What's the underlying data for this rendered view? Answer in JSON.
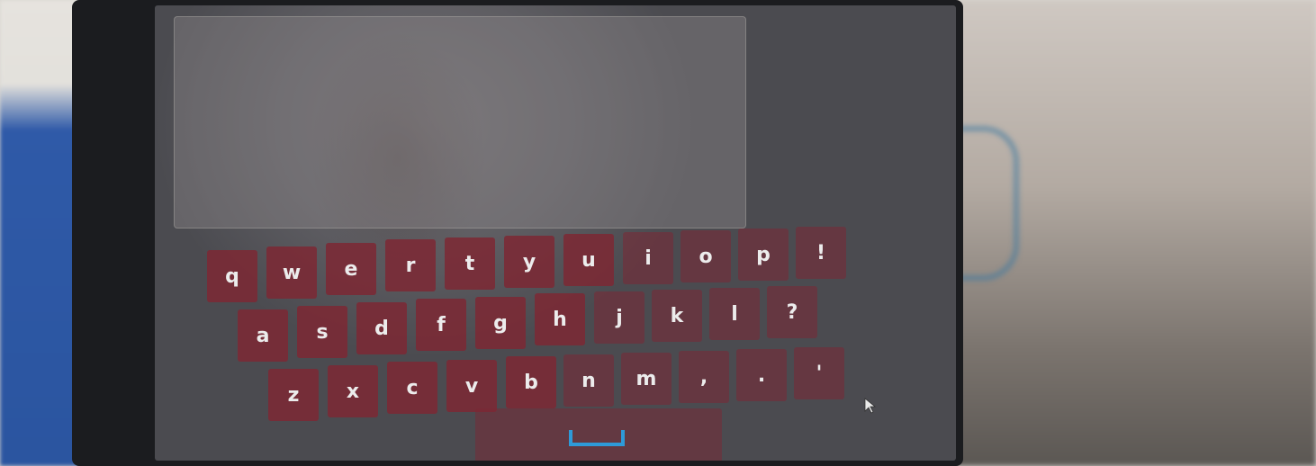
{
  "keyboard": {
    "rows": [
      [
        "q",
        "w",
        "e",
        "r",
        "t",
        "y",
        "u",
        "i",
        "o",
        "p",
        "!"
      ],
      [
        "a",
        "s",
        "d",
        "f",
        "g",
        "h",
        "j",
        "k",
        "l",
        "?"
      ],
      [
        "z",
        "x",
        "c",
        "v",
        "b",
        "n",
        "m",
        ",",
        ".",
        "'"
      ]
    ],
    "space_icon": "space-bar-icon"
  },
  "colors": {
    "key": "#7c2834",
    "space_icon": "#2e9ad8",
    "text_area": "#8c888a"
  }
}
